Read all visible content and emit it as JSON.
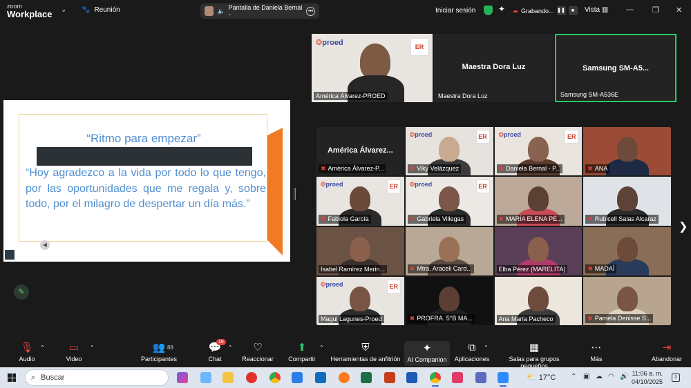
{
  "app": {
    "brand_top": "zoom",
    "brand_bottom": "Workplace",
    "meeting_label": "Reunión"
  },
  "share": {
    "label": "Pantalla de Daniela Bernal -"
  },
  "header": {
    "signin": "Iniciar sesión",
    "recording": "Grabando...",
    "view": "Vista"
  },
  "slide": {
    "title": "“Ritmo para empezar”",
    "quote": "“Hoy agradezco a la vida por todo lo que tengo, por las oportunidades que me regala y, sobre todo, por el milagro de despertar un día más.”"
  },
  "speakers": [
    {
      "name": "",
      "label": "América Álvarez-PROED"
    },
    {
      "name": "Maestra Dora Luz",
      "label": "Maestra Dora Luz"
    },
    {
      "name": "Samsung  SM-A5...",
      "label": "Samsung SM-A536E"
    }
  ],
  "grid": [
    {
      "label": "América Álvarez-P...",
      "name": "América Álvarez..."
    },
    {
      "label": "Viky Velázquez",
      "name": ""
    },
    {
      "label": "Daniela Bernal - P...",
      "name": ""
    },
    {
      "label": "ANA",
      "name": ""
    },
    {
      "label": "Fabiola García",
      "name": ""
    },
    {
      "label": "Gabriela Villegas",
      "name": ""
    },
    {
      "label": "MARÍA ELENA PÉ...",
      "name": ""
    },
    {
      "label": "Rubicell Salas Alcaraz",
      "name": ""
    },
    {
      "label": "Isabel Ramírez Merin...",
      "name": ""
    },
    {
      "label": "Mtra. Araceli Card...",
      "name": ""
    },
    {
      "label": "Elba Pérez (MARELITA)",
      "name": ""
    },
    {
      "label": "MADAÍ",
      "name": ""
    },
    {
      "label": "Magui Lagunes-Proed",
      "name": ""
    },
    {
      "label": "PROFRA. 5°B MA...",
      "name": ""
    },
    {
      "label": "Ana María Pacheco",
      "name": ""
    },
    {
      "label": "Pamela Denisse S...",
      "name": ""
    }
  ],
  "brand_marks": {
    "proed": "proed",
    "er": "ER"
  },
  "toolbar": {
    "audio": "Audio",
    "video": "Video",
    "participants": "Participantes",
    "participants_count": "88",
    "chat": "Chat",
    "chat_badge": "16",
    "react": "Reaccionar",
    "share": "Compartir",
    "host_tools": "Herramientas de anfitrión",
    "ai": "AI Companion",
    "apps": "Aplicaciones",
    "breakout": "Salas para grupos pequeños",
    "more": "Más",
    "leave": "Abandonar"
  },
  "taskbar": {
    "search_placeholder": "Buscar",
    "temperature": "17°C",
    "time": "11:06 a. m.",
    "date": "04/10/2025"
  },
  "colors": {
    "accent": "#2ac76a",
    "alert": "#e0413c",
    "slide_text": "#4f8fd1",
    "slide_orange": "#f07b24"
  }
}
